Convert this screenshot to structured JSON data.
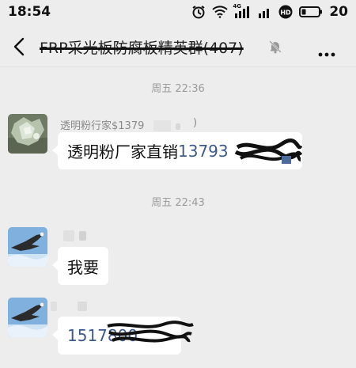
{
  "status_bar": {
    "time": "18:54",
    "signal_label": "4G",
    "battery_level": "20"
  },
  "nav": {
    "title": "FRP采光板防腐板精英群(407)"
  },
  "messages": [
    {
      "time": "周五 22:36"
    },
    {
      "sender": "透明粉行家$1379",
      "sender_tail": ")",
      "text": "透明粉厂家直销 ",
      "phone": "13793"
    },
    {
      "time": "周五 22:43"
    },
    {
      "text": "我要"
    },
    {
      "phone": "1517800"
    }
  ],
  "colors": {
    "background": "#ededed",
    "bubble": "#ffffff",
    "phone_link": "#3d5a8a",
    "timestamp": "#9b9b9b"
  },
  "icons": [
    "alarm-icon",
    "wifi-icon",
    "signal-icon",
    "hd-icon",
    "battery-icon",
    "back-icon",
    "mute-icon",
    "more-icon"
  ]
}
